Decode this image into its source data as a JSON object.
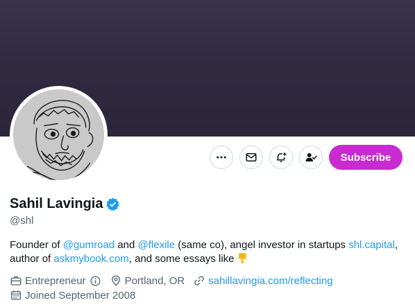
{
  "profile": {
    "display_name": "Sahil Lavingia",
    "handle": "@shl",
    "verified": true
  },
  "actions": {
    "more_icon": "more-icon",
    "message_icon": "envelope-icon",
    "notify_icon": "bell-plus-icon",
    "following_icon": "person-check-icon",
    "subscribe_label": "Subscribe",
    "subscribe_color": "#c92bd1"
  },
  "bio": {
    "p1": "Founder of ",
    "mention_gumroad": "@gumroad",
    "p2": " and ",
    "mention_flexile": "@flexile",
    "p3": " (same co), angel investor in startups ",
    "link_capital": "shl.capital",
    "p4": ", author of ",
    "link_askmybook": "askmybook.com",
    "p5": ", and some essays like"
  },
  "meta": {
    "category": "Entrepreneur",
    "location": "Portland, OR",
    "website": "sahillavingia.com/reflecting",
    "joined": "Joined September 2008"
  },
  "colors": {
    "link": "#1d9bf0",
    "secondary_text": "#536471",
    "banner": "#2f2940"
  }
}
